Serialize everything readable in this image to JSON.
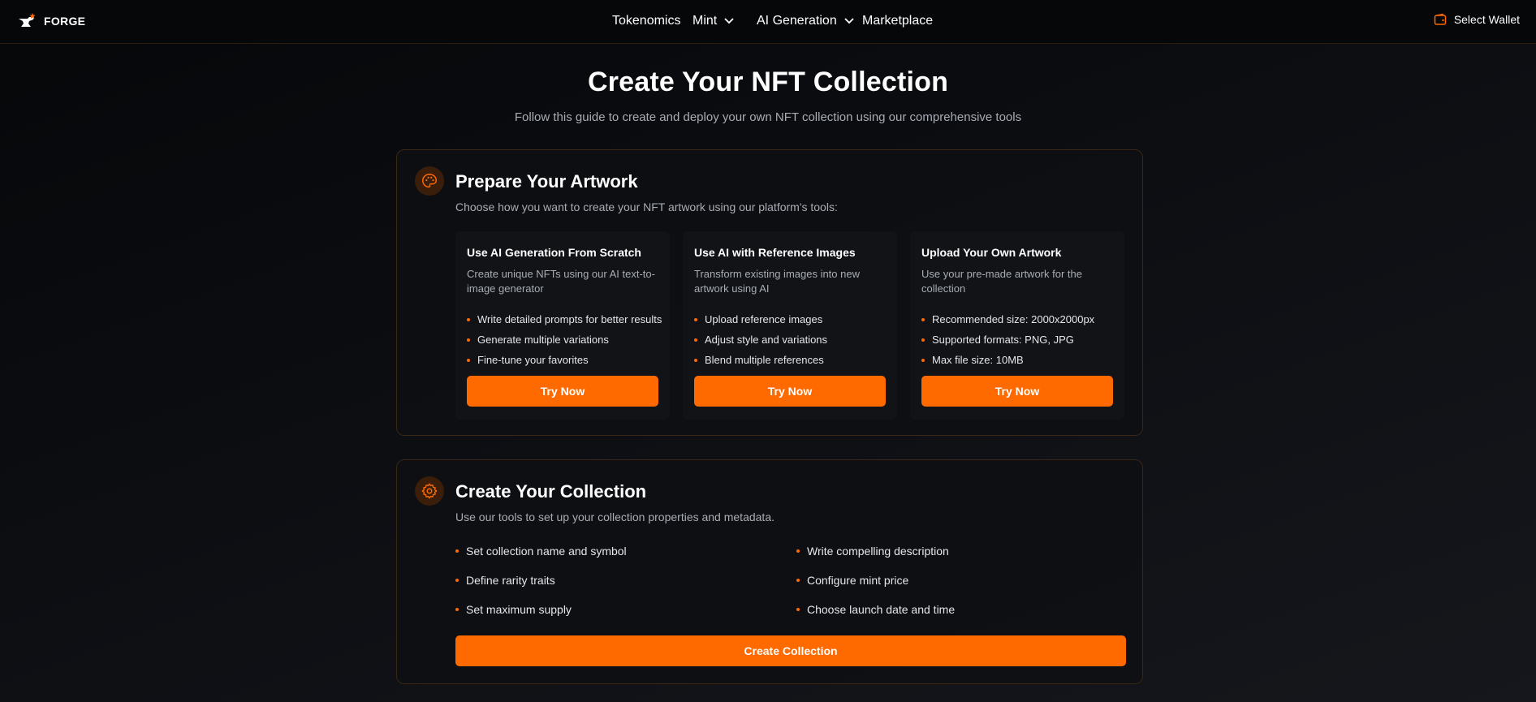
{
  "header": {
    "brand": "FORGE",
    "nav": [
      {
        "label": "Tokenomics",
        "dropdown": false
      },
      {
        "label": "Mint",
        "dropdown": true
      },
      {
        "label": "AI Generation",
        "dropdown": true
      },
      {
        "label": "Marketplace",
        "dropdown": false
      }
    ],
    "wallet_label": "Select Wallet"
  },
  "hero": {
    "title": "Create Your NFT Collection",
    "subtitle": "Follow this guide to create and deploy your own NFT collection using our comprehensive tools"
  },
  "artwork": {
    "title": "Prepare Your Artwork",
    "description": "Choose how you want to create your NFT artwork using our platform's tools:",
    "options": [
      {
        "title": "Use AI Generation From Scratch",
        "description": "Create unique NFTs using our AI text-to-image generator",
        "bullets": [
          "Write detailed prompts for better results",
          "Generate multiple variations",
          "Fine-tune your favorites"
        ],
        "button": "Try Now"
      },
      {
        "title": "Use AI with Reference Images",
        "description": "Transform existing images into new artwork using AI",
        "bullets": [
          "Upload reference images",
          "Adjust style and variations",
          "Blend multiple references"
        ],
        "button": "Try Now"
      },
      {
        "title": "Upload Your Own Artwork",
        "description": "Use your pre-made artwork for the collection",
        "bullets": [
          "Recommended size: 2000x2000px",
          "Supported formats: PNG, JPG",
          "Max file size: 10MB"
        ],
        "button": "Try Now"
      }
    ]
  },
  "collection": {
    "title": "Create Your Collection",
    "description": "Use our tools to set up your collection properties and metadata.",
    "features_left": [
      "Set collection name and symbol",
      "Define rarity traits",
      "Set maximum supply"
    ],
    "features_right": [
      "Write compelling description",
      "Configure mint price",
      "Choose launch date and time"
    ],
    "button": "Create Collection"
  },
  "theme": {
    "accent": "#ff6a00",
    "background": "#0b0d11",
    "card_border": "#3a2714"
  },
  "icons": {
    "logo": "anvil-star-icon",
    "wallet": "wallet-icon",
    "artwork": "palette-icon",
    "collection": "gear-icon",
    "dropdown": "chevron-down-icon"
  }
}
